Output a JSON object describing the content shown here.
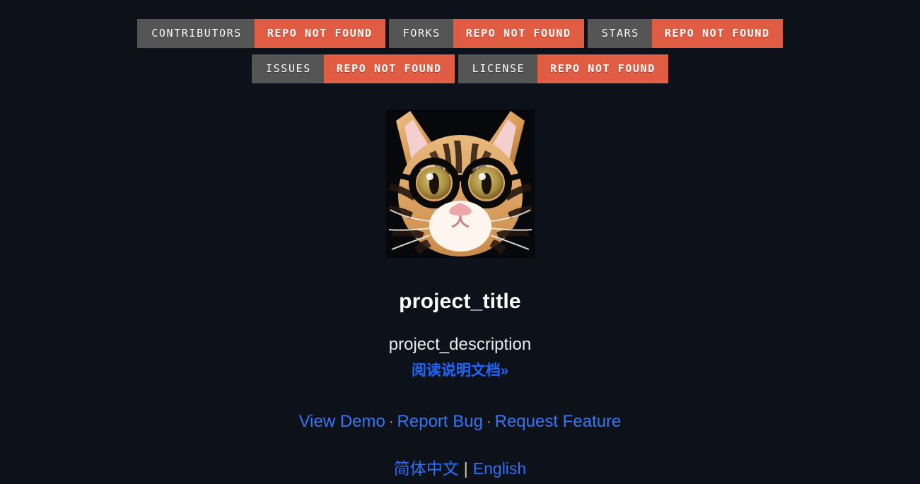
{
  "theme": {
    "background": "#0d111a",
    "badge_label_bg": "#555555",
    "badge_value_bg": "#e05d44",
    "link_blue": "#3576f5",
    "docs_link_blue": "#1f66ff",
    "title_color": "#ffffff"
  },
  "badges": {
    "row1": [
      {
        "label": "CONTRIBUTORS",
        "value": "REPO NOT FOUND"
      },
      {
        "label": "FORKS",
        "value": "REPO NOT FOUND"
      },
      {
        "label": "STARS",
        "value": "REPO NOT FOUND"
      }
    ],
    "row2": [
      {
        "label": "ISSUES",
        "value": "REPO NOT FOUND"
      },
      {
        "label": "LICENSE",
        "value": "REPO NOT FOUND"
      }
    ]
  },
  "logo": {
    "alt": "cat-with-glasses-logo",
    "icon": "project-logo-image"
  },
  "header": {
    "title": "project_title",
    "description": "project_description",
    "docs_link": "阅读说明文档",
    "docs_arrow": "»"
  },
  "links": [
    {
      "label": "View Demo"
    },
    {
      "label": "Report Bug"
    },
    {
      "label": "Request Feature"
    }
  ],
  "link_separator": "·",
  "languages": [
    {
      "label": "简体中文"
    },
    {
      "label": "English"
    }
  ],
  "language_separator": "|"
}
